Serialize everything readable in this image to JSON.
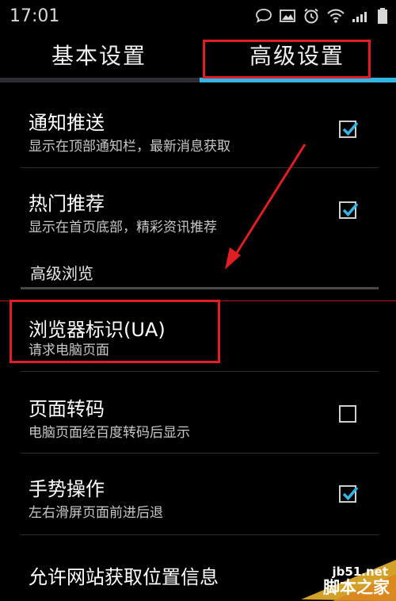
{
  "status_bar": {
    "time": "17:01",
    "icons": [
      "chat-icon",
      "image-icon",
      "alarm-icon",
      "wifi-icon",
      "signal-icon",
      "battery-icon"
    ]
  },
  "tabs": [
    {
      "label": "基本设置",
      "selected": false
    },
    {
      "label": "高级设置",
      "selected": true
    }
  ],
  "settings": {
    "notify_push": {
      "title": "通知推送",
      "subtitle": "显示在顶部通知栏，最新消息获取",
      "checked": true
    },
    "hot_recommend": {
      "title": "热门推荐",
      "subtitle": "显示在首页底部，精彩资讯推荐",
      "checked": true
    },
    "section_title": "高级浏览",
    "browser_ua": {
      "title": "浏览器标识(UA)",
      "subtitle": "请求电脑页面"
    },
    "page_transcode": {
      "title": "页面转码",
      "subtitle": "电脑页面经百度转码后显示",
      "checked": false
    },
    "gesture": {
      "title": "手势操作",
      "subtitle": "左右滑屏页面前进后退",
      "checked": true
    },
    "location": {
      "title": "允许网站获取位置信息"
    }
  },
  "watermark": {
    "url": "jb51.net",
    "name": "脚本之家"
  },
  "colors": {
    "accent": "#33b5e5",
    "annotation": "#e01e24",
    "checkmark": "#33b5e5"
  }
}
